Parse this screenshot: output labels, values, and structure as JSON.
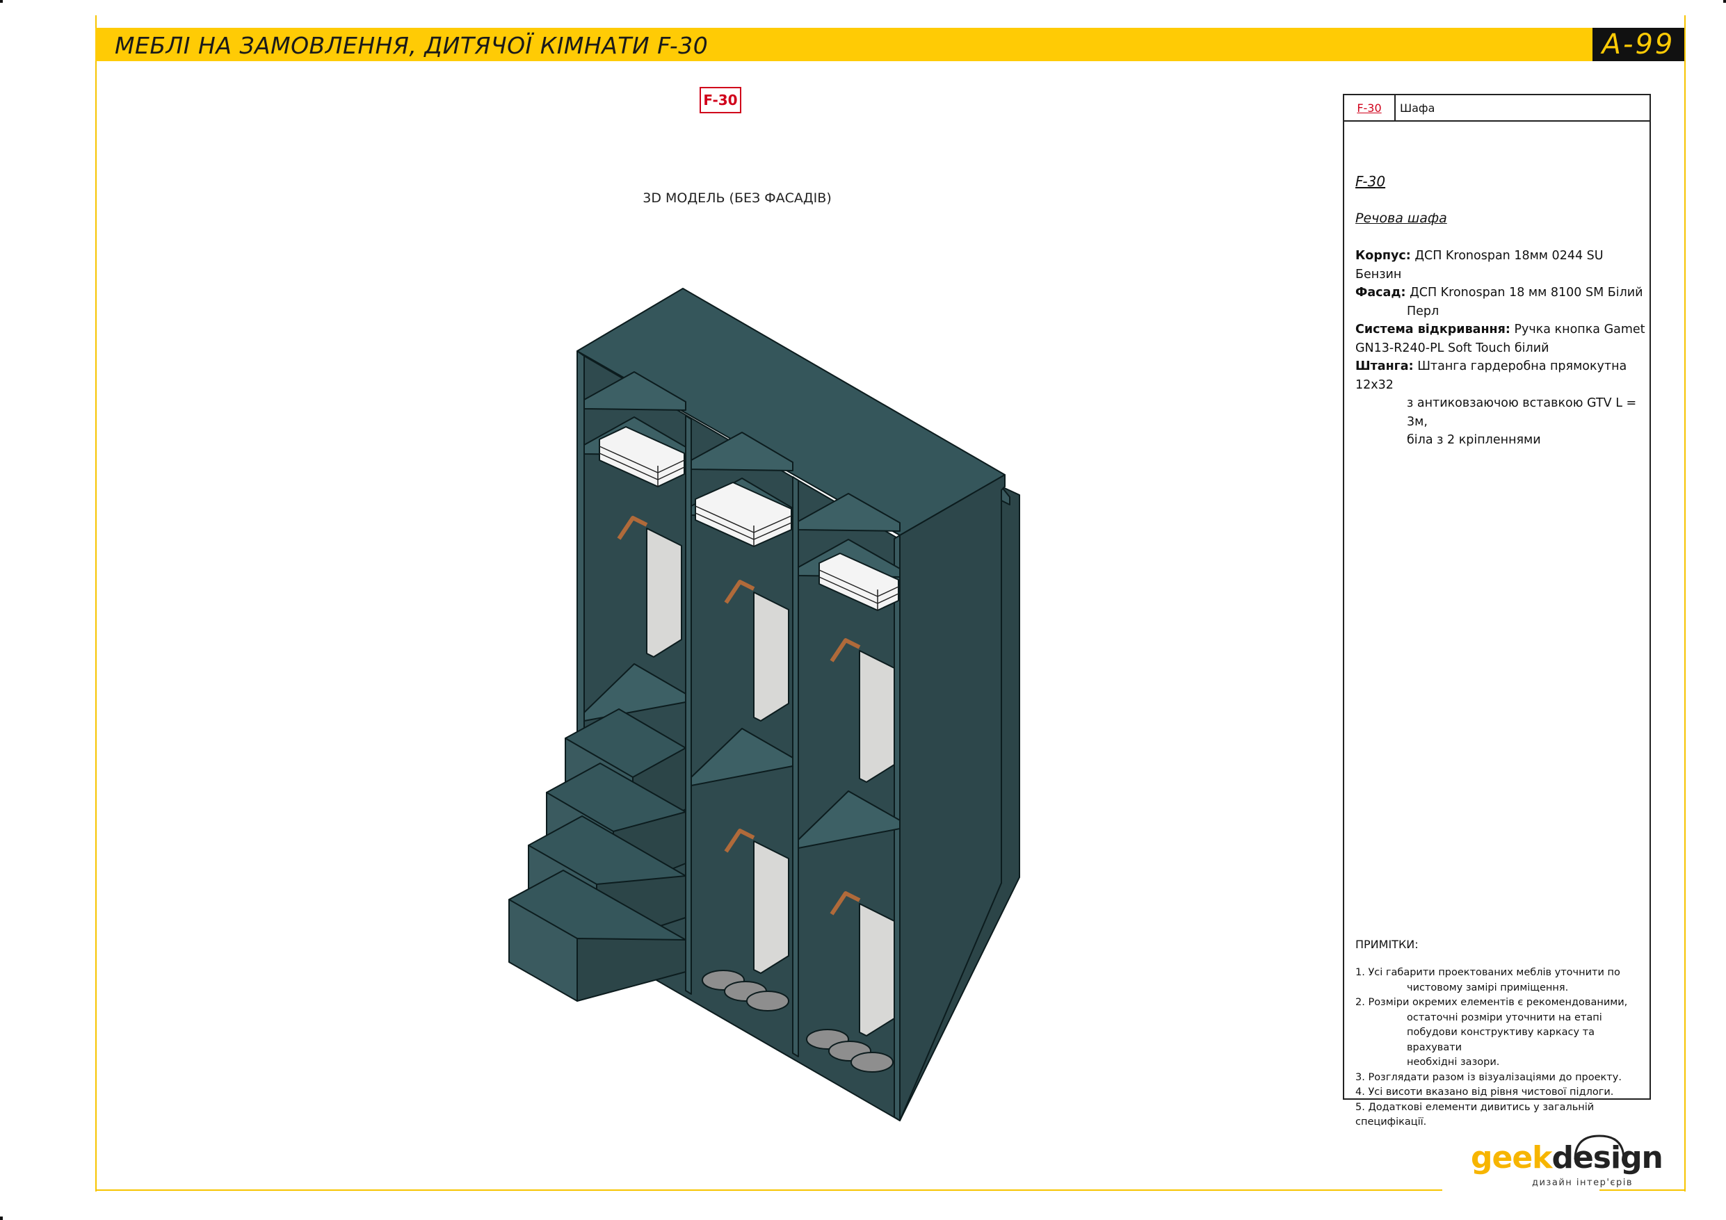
{
  "header": {
    "title": "МЕБЛІ НА ЗАМОВЛЕННЯ, ДИТЯЧОЇ КІМНАТИ F-30",
    "sheet_number": "A-99"
  },
  "drawing": {
    "item_tag": "F-30",
    "view_caption": "3D МОДЕЛЬ (БЕЗ ФАСАДІВ)",
    "colors": {
      "panel_front": "#3a5a5f",
      "panel_top": "#35565b",
      "panel_side": "#2c4548",
      "interior": "#2f4a4e"
    }
  },
  "spec": {
    "head_code": "F-30",
    "head_name": "Шафа",
    "code": "F-30",
    "subtitle": "Речова шафа",
    "rows": [
      {
        "label": "Корпус:",
        "text": "ДСП Kronospan 18мм  0244 SU Бензин"
      },
      {
        "label": "Фасад:",
        "text": "ДСП Kronospan 18 мм 8100 SM Білий",
        "cont": "Перл"
      },
      {
        "label": "Система відкривання:",
        "text": "Ручка кнопка Gamet",
        "cont2": "GN13-R240-PL Soft Touch білий"
      },
      {
        "label": "Штанга:",
        "text": "Штанга гардеробна прямокутна 12x32",
        "cont": "з антиковзаючою вставкою GTV L = 3м,",
        "cont3": "біла з 2 кріпленнями"
      }
    ]
  },
  "notes": {
    "title": "ПРИМІТКИ:",
    "items": [
      {
        "first": "1. Усі габарити проектованих меблів уточнити по",
        "rest": [
          "чистовому замірі приміщення."
        ]
      },
      {
        "first": "2. Розміри окремих елементів є рекомендованими,",
        "rest": [
          "остаточні розміри уточнити на етапі",
          "побудови конструктиву каркасу та врахувати",
          "необхідні зазори."
        ]
      },
      {
        "first": "3. Розглядати разом із візуалізаціями до проекту.",
        "rest": []
      },
      {
        "first": "4. Усі висоти вказано від рівня чистової підлоги.",
        "rest": []
      },
      {
        "first": "5. Додаткові елементи дивитись у загальній специфікації.",
        "rest": []
      }
    ]
  },
  "logo": {
    "geek": "geek",
    "design": "design",
    "tagline": "дизайн інтер'єрів"
  }
}
